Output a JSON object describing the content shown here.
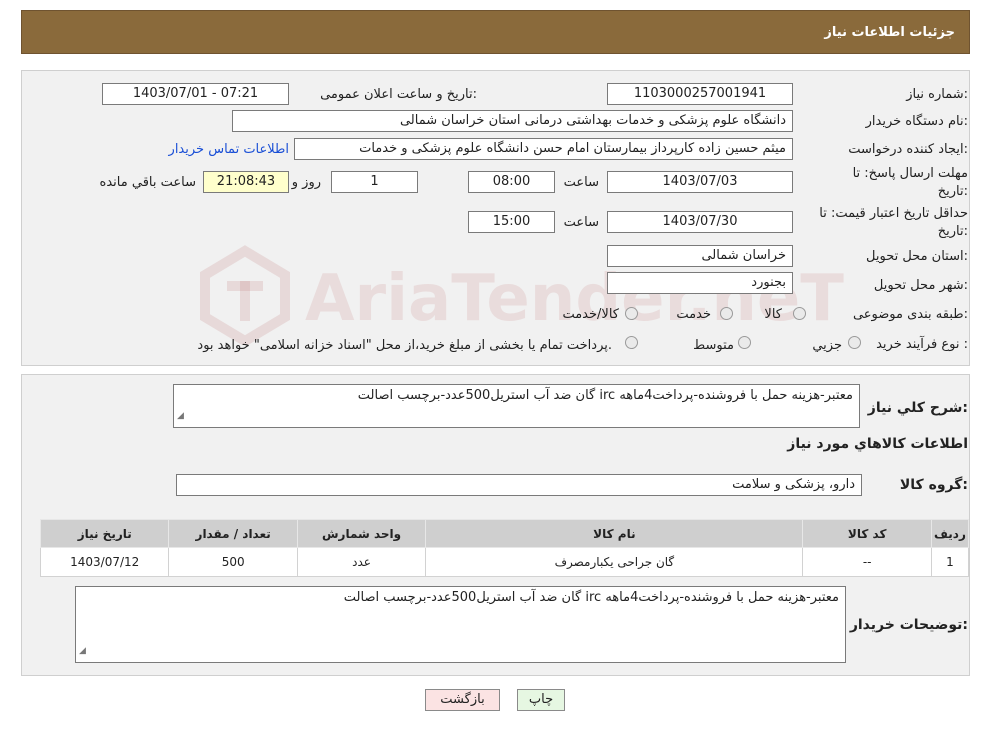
{
  "header": {
    "title": "جزئیات اطلاعات نیاز"
  },
  "watermark": "AriaTender.neT",
  "form": {
    "need_number_label": "شماره نیاز:",
    "need_number": "1103000257001941",
    "announce_label": "تاریخ و ساعت اعلان عمومی:",
    "announce_value": "1403/07/01 - 07:21",
    "buyer_org_label": "نام دستگاه خریدار:",
    "buyer_org": "دانشگاه علوم پزشکی و خدمات بهداشتی درمانی استان خراسان شمالی",
    "creator_label": "ایجاد کننده درخواست:",
    "creator": "میثم  حسین زاده  کارپرداز بیمارستان امام حسن دانشگاه علوم پزشکی و خدمات",
    "contact_link": "اطلاعات تماس خریدار",
    "deadline_label_1": "مهلت ارسال پاسخ: تا",
    "deadline_label_2": "تاریخ:",
    "deadline_date": "1403/07/03",
    "time_label": "ساعت",
    "deadline_time": "08:00",
    "days_value": "1",
    "days_label": "روز و",
    "remaining_time": "21:08:43",
    "remaining_label": "ساعت باقي مانده",
    "validity_label_1": "حداقل تاریخ اعتبار قیمت: تا",
    "validity_label_2": "تاریخ:",
    "validity_date": "1403/07/30",
    "validity_time": "15:00",
    "province_label": "استان محل تحویل:",
    "province": "خراسان شمالی",
    "city_label": "شهر محل تحویل:",
    "city": "بجنورد",
    "category_label": "طبقه بندی موضوعی:",
    "category_options": [
      "کالا",
      "خدمت",
      "کالا/خدمت"
    ],
    "process_label": "نوع فرآیند خرید :",
    "process_options": [
      "جزیي",
      "متوسط"
    ],
    "process_note": "پرداخت تمام یا بخشی از مبلغ خرید،از محل \"اسناد خزانه اسلامی\" خواهد بود."
  },
  "details": {
    "description_label": "شرح کلي نياز:",
    "description": "گان ضد آب استریل500عدد-برچسب اصالت irc معتبر-هزینه حمل با فروشنده-پرداخت4ماهه",
    "goods_info_title": "اطلاعات کالاهاي مورد نياز",
    "goods_group_label": "گروه کالا:",
    "goods_group": "دارو، پزشکی و سلامت",
    "table": {
      "headers": [
        "رديف",
        "کد کالا",
        "نام کالا",
        "واحد شمارش",
        "تعداد / مقدار",
        "تاريخ نياز"
      ],
      "rows": [
        [
          "1",
          "--",
          "گان جراحی یکبارمصرف",
          "عدد",
          "500",
          "1403/07/12"
        ]
      ]
    },
    "buyer_notes_label": "توضیحات خریدار:",
    "buyer_notes": "گان ضد آب استریل500عدد-برچسب اصالت irc معتبر-هزینه حمل با فروشنده-پرداخت4ماهه"
  },
  "buttons": {
    "print": "چاپ",
    "back": "بازگشت"
  }
}
